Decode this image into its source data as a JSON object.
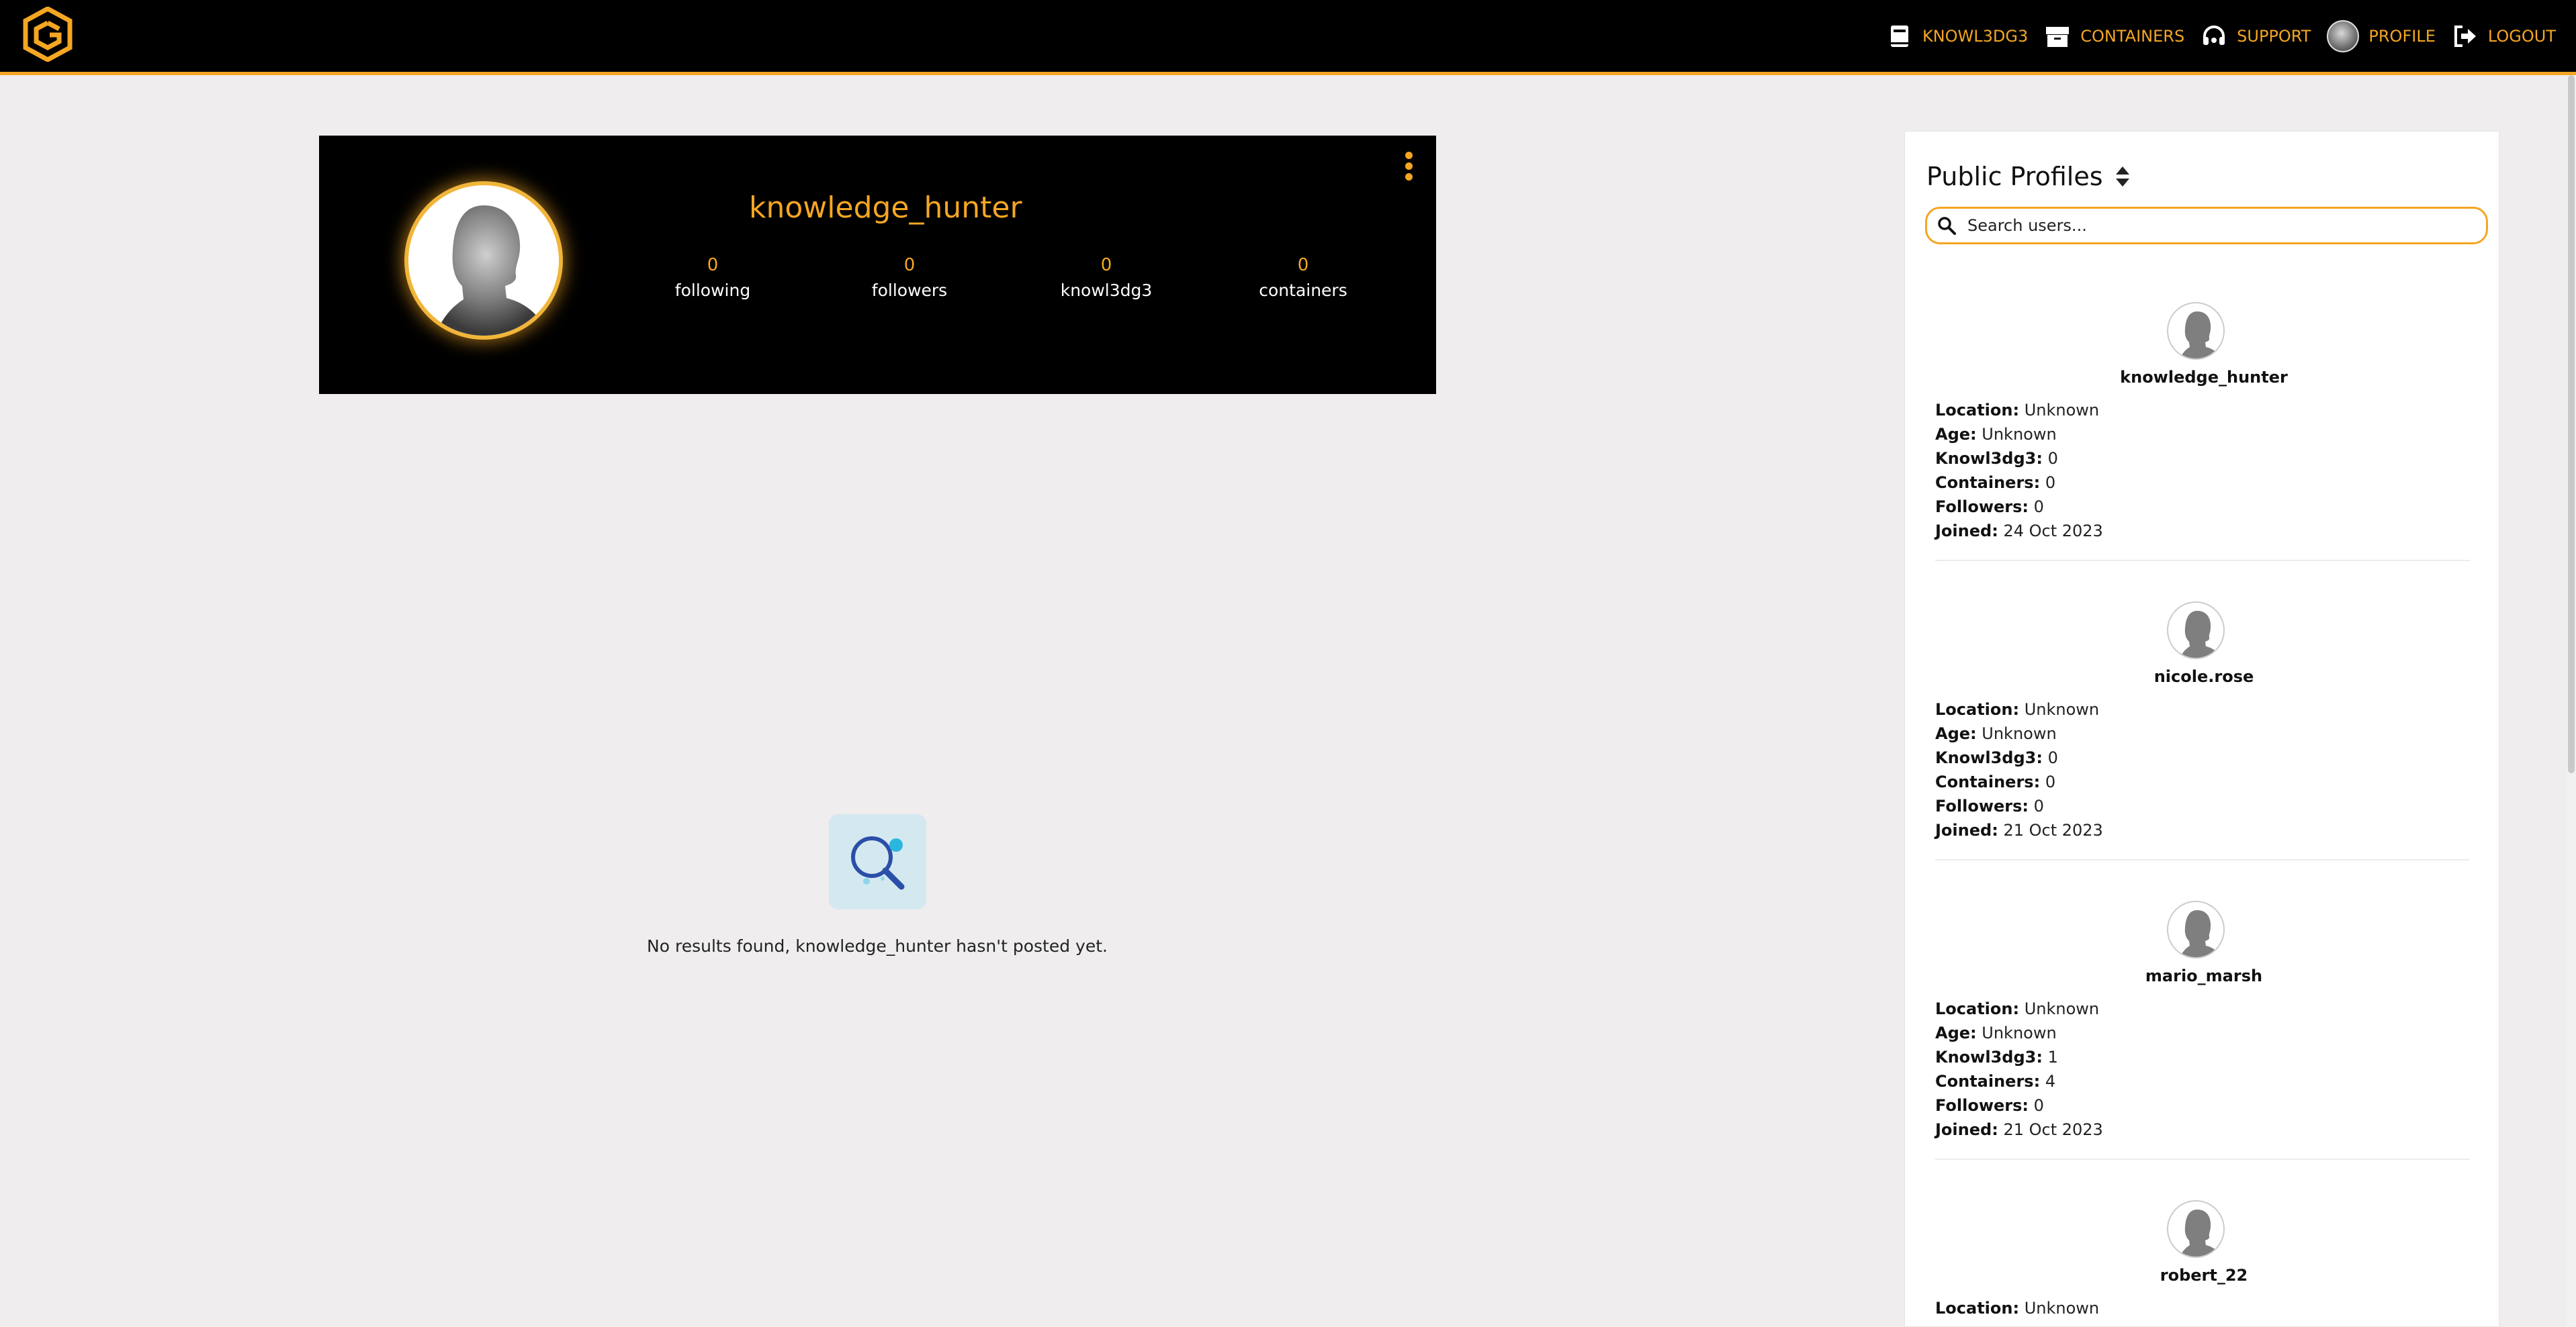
{
  "nav": {
    "items": [
      {
        "label": "KNOWL3DG3",
        "icon": "book-icon"
      },
      {
        "label": "CONTAINERS",
        "icon": "box-icon"
      },
      {
        "label": "SUPPORT",
        "icon": "headset-icon"
      },
      {
        "label": "PROFILE",
        "icon": "avatar"
      },
      {
        "label": "LOGOUT",
        "icon": "logout-icon"
      }
    ]
  },
  "profile": {
    "username": "knowledge_hunter",
    "stats": [
      {
        "value": "0",
        "label": "following"
      },
      {
        "value": "0",
        "label": "followers"
      },
      {
        "value": "0",
        "label": "knowl3dg3"
      },
      {
        "value": "0",
        "label": "containers"
      }
    ]
  },
  "empty_state": {
    "message": "No results found, knowledge_hunter hasn't posted yet."
  },
  "sidebar": {
    "title": "Public Profiles",
    "search_placeholder": "Search users...",
    "field_labels": {
      "location": "Location:",
      "age": "Age:",
      "knowl3dg3": "Knowl3dg3:",
      "containers": "Containers:",
      "followers": "Followers:",
      "joined": "Joined:"
    },
    "users": [
      {
        "name": "knowledge_hunter",
        "location": "Unknown",
        "age": "Unknown",
        "knowl3dg3": "0",
        "containers": "0",
        "followers": "0",
        "joined": "24 Oct 2023"
      },
      {
        "name": "nicole.rose",
        "location": "Unknown",
        "age": "Unknown",
        "knowl3dg3": "0",
        "containers": "0",
        "followers": "0",
        "joined": "21 Oct 2023"
      },
      {
        "name": "mario_marsh",
        "location": "Unknown",
        "age": "Unknown",
        "knowl3dg3": "1",
        "containers": "4",
        "followers": "0",
        "joined": "21 Oct 2023"
      },
      {
        "name": "robert_22",
        "location": "Unknown"
      }
    ]
  },
  "colors": {
    "accent": "#f5a623",
    "header_bg": "#000000",
    "page_bg": "#efeded"
  }
}
